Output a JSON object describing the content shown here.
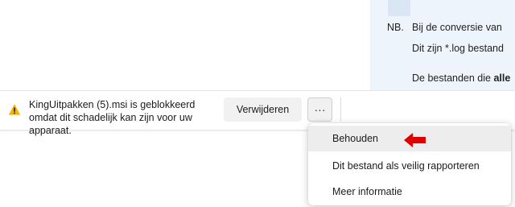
{
  "document": {
    "nb_label": "NB.",
    "line1": "Bij de conversie van",
    "line2": "Dit zijn *.log bestand",
    "line3_prefix": "De bestanden die ",
    "line3_bold": "alle"
  },
  "download_bar": {
    "message": "KingUitpakken (5).msi is geblokkeerd omdat dit schadelijk kan zijn voor uw apparaat.",
    "remove_label": "Verwijderen",
    "more_label": "···",
    "warning_icon": "warning-triangle-icon",
    "warning_color": "#f4b400"
  },
  "menu": {
    "items": [
      {
        "label": "Behouden"
      },
      {
        "label": "Dit bestand als veilig rapporteren"
      },
      {
        "label": "Meer informatie"
      }
    ]
  },
  "annotation": {
    "arrow_color": "#e00000",
    "arrow_icon": "red-arrow-left-icon"
  }
}
